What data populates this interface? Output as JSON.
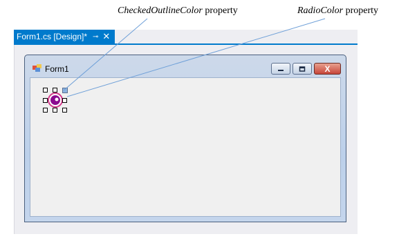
{
  "annotations": {
    "checked_outline": {
      "italic": "CheckedOutlineColor",
      "suffix": " property"
    },
    "radio_color": {
      "italic": "RadioColor",
      "suffix": " property"
    }
  },
  "tab": {
    "title": "Form1.cs [Design]*",
    "pin_icon": "⊸",
    "close_icon": "✕"
  },
  "form": {
    "title": "Form1",
    "close_glyph": "X"
  },
  "colors": {
    "accent": "#007acc",
    "radio_fill": "#8b0a8f",
    "radio_outline": "#d23a8a",
    "leader": "#6fa0d8"
  }
}
